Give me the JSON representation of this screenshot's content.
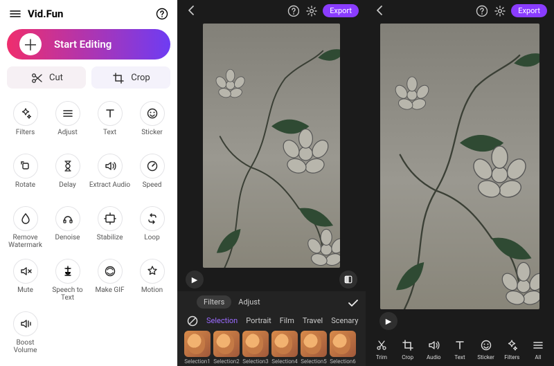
{
  "side": {
    "app_name": "Vid.Fun",
    "start_label": "Start Editing",
    "cut_label": "Cut",
    "crop_label": "Crop",
    "tools": [
      {
        "id": "filters",
        "label": "Filters"
      },
      {
        "id": "adjust",
        "label": "Adjust"
      },
      {
        "id": "text",
        "label": "Text"
      },
      {
        "id": "sticker",
        "label": "Sticker"
      },
      {
        "id": "rotate",
        "label": "Rotate"
      },
      {
        "id": "delay",
        "label": "Delay"
      },
      {
        "id": "extract-audio",
        "label": "Extract Audio"
      },
      {
        "id": "speed",
        "label": "Speed"
      },
      {
        "id": "remove-watermark",
        "label": "Remove\nWatermark"
      },
      {
        "id": "denoise",
        "label": "Denoise"
      },
      {
        "id": "stabilize",
        "label": "Stabilize"
      },
      {
        "id": "loop",
        "label": "Loop"
      },
      {
        "id": "mute",
        "label": "Mute"
      },
      {
        "id": "speech-to-text",
        "label": "Speech to\nText"
      },
      {
        "id": "make-gif",
        "label": "Make GIF"
      },
      {
        "id": "motion",
        "label": "Motion"
      },
      {
        "id": "boost-volume",
        "label": "Boost Volume"
      }
    ]
  },
  "editor": {
    "export_label": "Export",
    "filters_tab": "Filters",
    "adjust_tab": "Adjust",
    "categories": [
      "Selection",
      "Portrait",
      "Film",
      "Travel",
      "Scenary"
    ],
    "selected_category": "Selection",
    "thumbs": [
      "Selection1",
      "Selection2",
      "Selection3",
      "Selection4",
      "Selection5",
      "Selection6"
    ],
    "bottom_tools": [
      {
        "id": "trim",
        "label": "Trim"
      },
      {
        "id": "crop",
        "label": "Crop"
      },
      {
        "id": "audio",
        "label": "Audio"
      },
      {
        "id": "text",
        "label": "Text"
      },
      {
        "id": "sticker",
        "label": "Sticker"
      },
      {
        "id": "filters",
        "label": "Filters"
      },
      {
        "id": "all",
        "label": "All"
      }
    ]
  }
}
